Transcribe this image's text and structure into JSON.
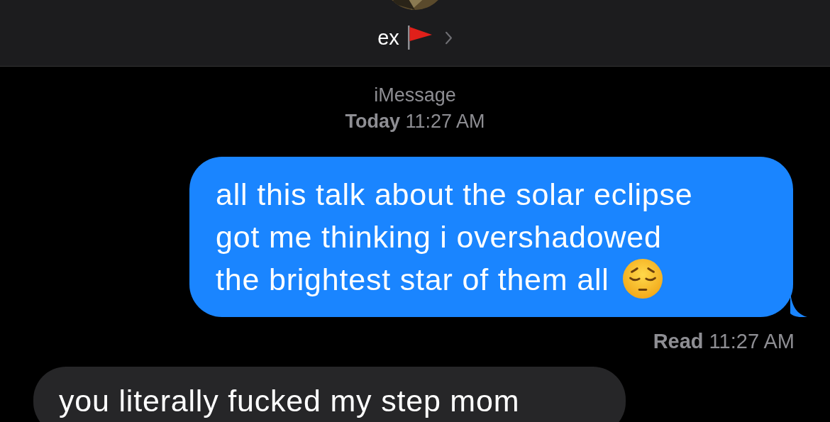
{
  "header": {
    "contact_name": "ex",
    "has_flag": true
  },
  "thread_info": {
    "service": "iMessage",
    "timestamp": "**Today** 11:27 AM"
  },
  "messages": [
    {
      "kind": "sent",
      "lines": [
        "all this talk about the solar eclipse",
        "got me thinking i overshadowed",
        "the brightest star of them all"
      ],
      "has_emoji": true
    },
    {
      "kind": "received",
      "lines": [
        "you literally fucked my step mom"
      ],
      "has_emoji": false
    }
  ],
  "receipt": "**Read** 11:27 AM"
}
